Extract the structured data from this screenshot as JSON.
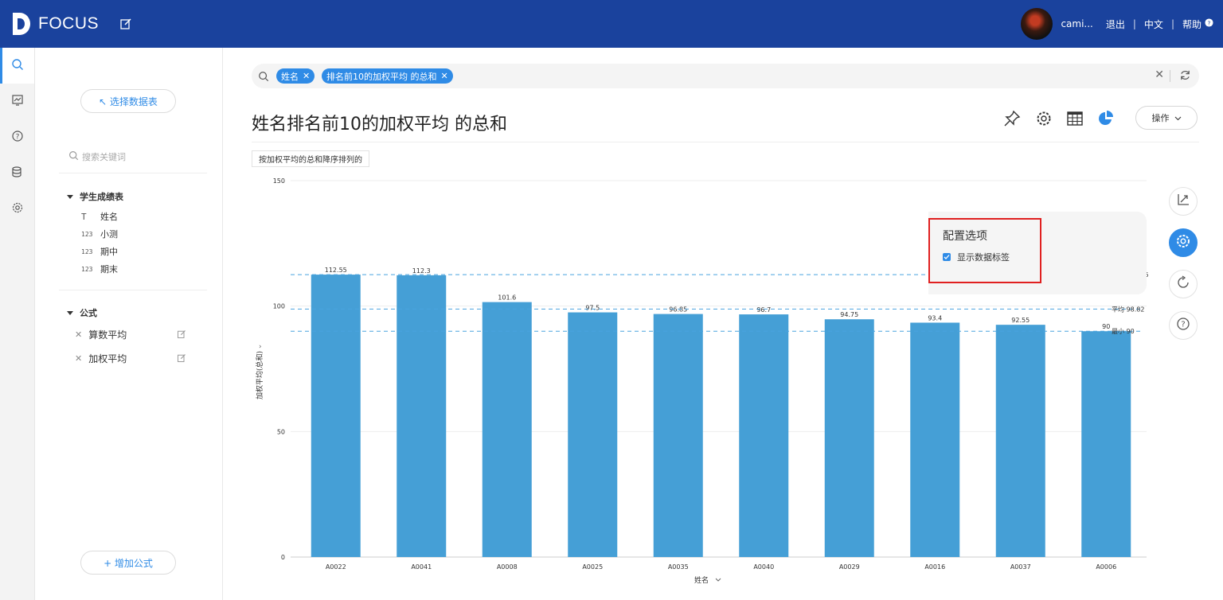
{
  "header": {
    "logo_text": "FOCUS",
    "username": "cami...",
    "logout": "退出",
    "language": "中文",
    "help": "帮助",
    "bar_color": "#1a429d"
  },
  "leftnav": {
    "items": [
      "search-icon",
      "board-icon",
      "help-icon",
      "database-icon",
      "settings-icon"
    ]
  },
  "panel": {
    "select_table_label": "↖ 选择数据表",
    "search_placeholder": "搜索关键词",
    "table_name": "学生成绩表",
    "fields": [
      {
        "type": "T",
        "name": "姓名"
      },
      {
        "type": "123",
        "name": "小测"
      },
      {
        "type": "123",
        "name": "期中"
      },
      {
        "type": "123",
        "name": "期末"
      }
    ],
    "formula_title": "公式",
    "formulas": [
      "算数平均",
      "加权平均"
    ],
    "add_formula_label": "+ 增加公式"
  },
  "query": {
    "chips": [
      "姓名",
      "排名前10的加权平均  的总和"
    ]
  },
  "main": {
    "title": "姓名排名前10的加权平均 的总和",
    "operate_label": "操作",
    "sort_tag": "按加权平均的总和降序排列的"
  },
  "config": {
    "title": "配置选项",
    "show_labels": "显示数据标签",
    "show_labels_checked": true
  },
  "chart_data": {
    "type": "bar",
    "categories": [
      "A0022",
      "A0041",
      "A0008",
      "A0025",
      "A0035",
      "A0040",
      "A0029",
      "A0016",
      "A0037",
      "A0006"
    ],
    "values": [
      112.55,
      112.3,
      101.6,
      97.5,
      96.85,
      96.7,
      94.75,
      93.4,
      92.55,
      90
    ],
    "value_labels": [
      "112.55",
      "112.3",
      "101.6",
      "97.5",
      "96.85",
      "96.7",
      "94.75",
      "93.4",
      "92.55",
      "90"
    ],
    "ylim": [
      0,
      150
    ],
    "yticks": [
      0,
      50,
      100,
      150
    ],
    "ylabel": "加权平均(总和)",
    "xlabel": "姓名",
    "bar_color": "#459fd6",
    "reference_lines": [
      {
        "label": "最大 112.55",
        "value": 112.55
      },
      {
        "label": "平均 98.82",
        "value": 98.82
      },
      {
        "label": "最小 90",
        "value": 90
      }
    ],
    "grid": true
  }
}
